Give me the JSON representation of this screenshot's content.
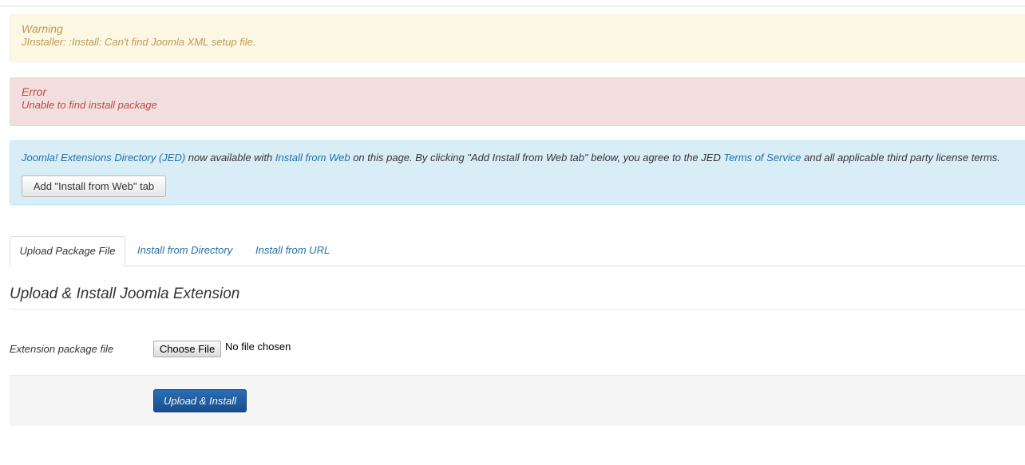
{
  "warning": {
    "heading": "Warning",
    "message": "JInstaller: :Install: Can't find Joomla XML setup file."
  },
  "error": {
    "heading": "Error",
    "message": "Unable to find install package"
  },
  "info": {
    "jed_link": "Joomla! Extensions Directory (JED)",
    "text_1": " now available with ",
    "install_from_web_link": "Install from Web",
    "text_2": " on this page.  By clicking \"Add Install from Web tab\" below, you agree to the JED ",
    "terms_link": "Terms of Service",
    "text_3": " and all applicable third party license terms.",
    "add_tab_button": "Add \"Install from Web\" tab"
  },
  "tabs": [
    {
      "label": "Upload Package File",
      "active": true
    },
    {
      "label": "Install from Directory",
      "active": false
    },
    {
      "label": "Install from URL",
      "active": false
    }
  ],
  "section": {
    "title": "Upload & Install Joomla Extension",
    "field_label": "Extension package file",
    "choose_file_label": "Choose File",
    "file_status": "No file chosen",
    "submit_label": "Upload & Install"
  },
  "colors": {
    "link": "#2071a4",
    "warning_text": "#c09853",
    "error_text": "#b94a48",
    "primary_button": "#1f5fa6"
  }
}
